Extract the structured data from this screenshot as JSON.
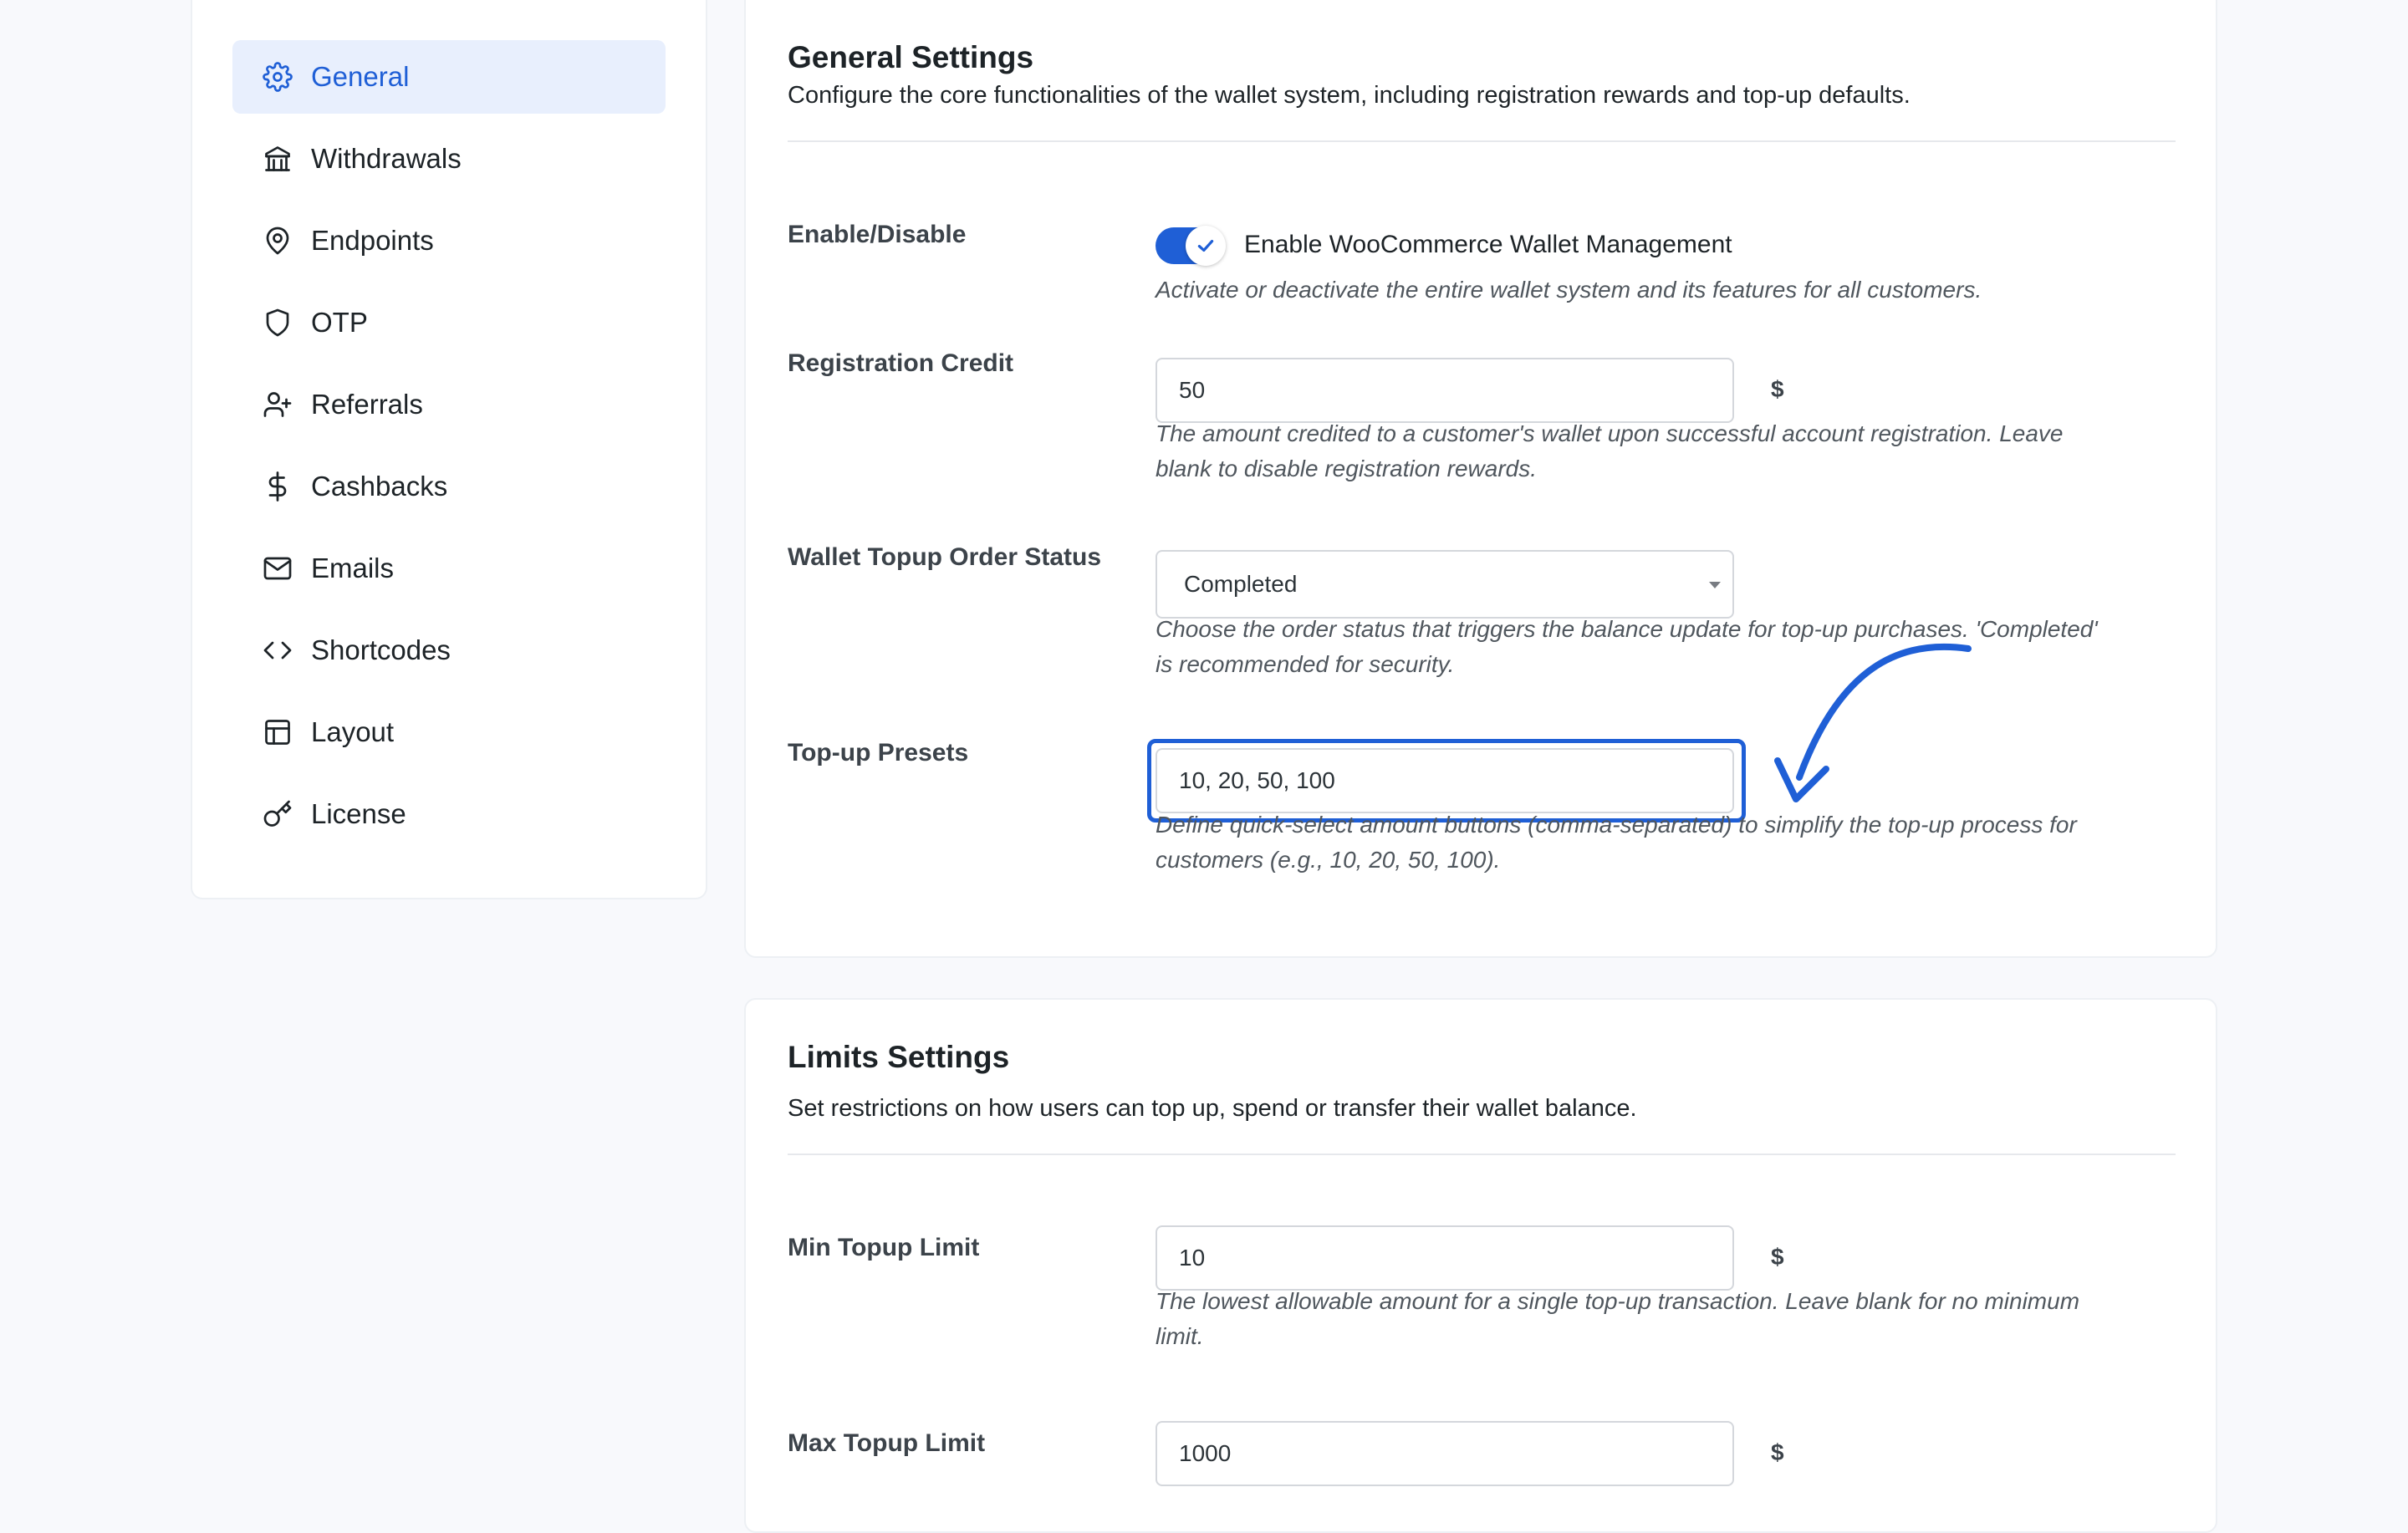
{
  "sidebar": {
    "items": [
      {
        "label": "General",
        "icon": "gear-icon",
        "active": true
      },
      {
        "label": "Withdrawals",
        "icon": "bank-icon"
      },
      {
        "label": "Endpoints",
        "icon": "map-pin-icon"
      },
      {
        "label": "OTP",
        "icon": "shield-icon"
      },
      {
        "label": "Referrals",
        "icon": "user-plus-icon"
      },
      {
        "label": "Cashbacks",
        "icon": "dollar-icon"
      },
      {
        "label": "Emails",
        "icon": "mail-icon"
      },
      {
        "label": "Shortcodes",
        "icon": "code-icon"
      },
      {
        "label": "Layout",
        "icon": "layout-icon"
      },
      {
        "label": "License",
        "icon": "key-icon"
      }
    ]
  },
  "general": {
    "title": "General Settings",
    "description": "Configure the core functionalities of the wallet system, including registration rewards and top-up defaults.",
    "enable": {
      "label": "Enable/Disable",
      "toggle_label": "Enable WooCommerce Wallet Management",
      "checked": true,
      "help": "Activate or deactivate the entire wallet system and its features for all customers."
    },
    "registration_credit": {
      "label": "Registration Credit",
      "value": "50",
      "currency": "$",
      "help_line1": "The amount credited to a customer's wallet upon successful account registration. Leave",
      "help_line2": "blank to disable registration rewards."
    },
    "order_status": {
      "label": "Wallet Topup Order Status",
      "selected": "Completed",
      "help_line1": "Choose the order status that triggers the balance update for top-up purchases. 'Completed'",
      "help_line2": "is recommended for security."
    },
    "presets": {
      "label": "Top-up Presets",
      "value": "10, 20, 50, 100",
      "help_line1": "Define quick-select amount buttons (comma-separated) to simplify the top-up process for",
      "help_line2": "customers (e.g., 10, 20, 50, 100)."
    }
  },
  "limits": {
    "title": "Limits Settings",
    "description": "Set restrictions on how users can top up, spend or transfer their wallet balance.",
    "min_topup": {
      "label": "Min Topup Limit",
      "value": "10",
      "currency": "$",
      "help_line1": "The lowest allowable amount for a single top-up transaction. Leave blank for no minimum",
      "help_line2": "limit."
    },
    "max_topup": {
      "label": "Max Topup Limit",
      "value": "1000",
      "currency": "$"
    }
  },
  "colors": {
    "accent": "#1f5fd6",
    "active_bg": "#e8effd",
    "page_bg": "#f8f9fc"
  }
}
